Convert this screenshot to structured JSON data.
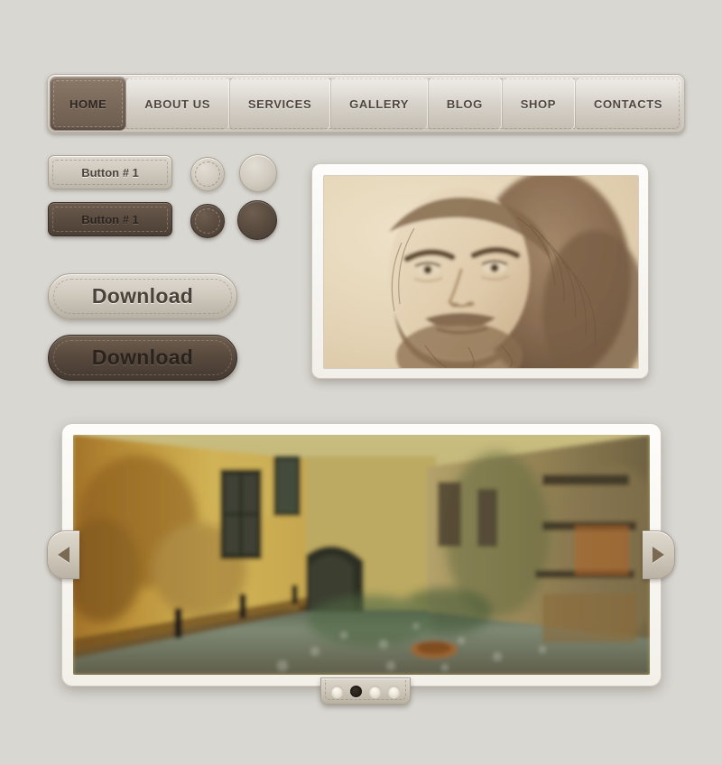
{
  "page": {
    "background_color": "#d9d7d2",
    "accent_dark": "#7b6a5b",
    "accent_light": "#cec8bd"
  },
  "navbar": {
    "items": [
      {
        "label": "HOME",
        "active": true
      },
      {
        "label": "ABOUT US",
        "active": false
      },
      {
        "label": "SERVICES",
        "active": false
      },
      {
        "label": "GALLERY",
        "active": false
      },
      {
        "label": "BLOG",
        "active": false
      },
      {
        "label": "SHOP",
        "active": false
      },
      {
        "label": "CONTACTS",
        "active": false
      }
    ]
  },
  "buttons": {
    "small_light_label": "Button # 1",
    "small_dark_label": "Button # 1",
    "download_light_label": "Download",
    "download_dark_label": "Download",
    "round": [
      {
        "name": "round-button-light-stitched",
        "style": "light",
        "stitched": true
      },
      {
        "name": "round-button-light-plain",
        "style": "light",
        "stitched": false
      },
      {
        "name": "round-button-dark-stitched",
        "style": "dark",
        "stitched": true
      },
      {
        "name": "round-button-dark-plain",
        "style": "dark",
        "stitched": false
      }
    ]
  },
  "portrait": {
    "icon": "portrait-image",
    "description": "Sepia pencil self-portrait sketch of an elderly bearded man (Leonardo da Vinci)"
  },
  "carousel": {
    "slide": {
      "icon": "street-photo",
      "description": "Old European town street with yellow ochre buildings, cobblestone road and an archway"
    },
    "prev_icon": "arrow-left-icon",
    "next_icon": "arrow-right-icon",
    "dots": [
      {
        "active": false
      },
      {
        "active": true
      },
      {
        "active": false
      },
      {
        "active": false
      }
    ]
  }
}
